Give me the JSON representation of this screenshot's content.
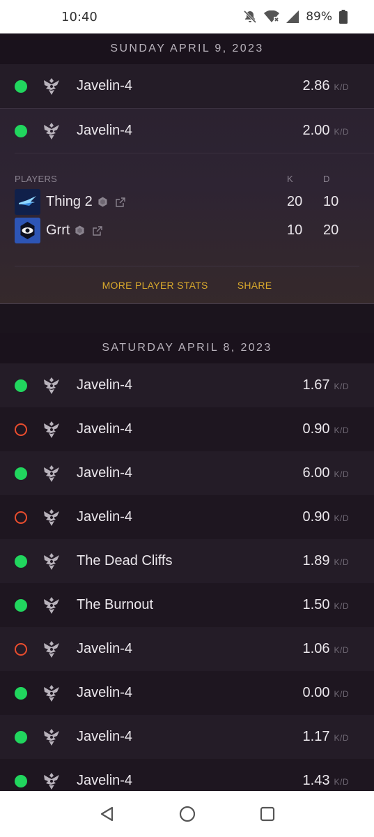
{
  "status": {
    "time": "10:40",
    "battery": "89%"
  },
  "sections": [
    {
      "date": "SUNDAY APRIL 9, 2023",
      "games": [
        {
          "map": "Javelin-4",
          "kd": "2.86",
          "result": "win"
        },
        {
          "map": "Javelin-4",
          "kd": "2.00",
          "result": "win",
          "expanded": true
        }
      ]
    },
    {
      "date": "SATURDAY APRIL 8, 2023",
      "games": [
        {
          "map": "Javelin-4",
          "kd": "1.67",
          "result": "win"
        },
        {
          "map": "Javelin-4",
          "kd": "0.90",
          "result": "loss"
        },
        {
          "map": "Javelin-4",
          "kd": "6.00",
          "result": "win"
        },
        {
          "map": "Javelin-4",
          "kd": "0.90",
          "result": "loss"
        },
        {
          "map": "The Dead Cliffs",
          "kd": "1.89",
          "result": "win"
        },
        {
          "map": "The Burnout",
          "kd": "1.50",
          "result": "win"
        },
        {
          "map": "Javelin-4",
          "kd": "1.06",
          "result": "loss"
        },
        {
          "map": "Javelin-4",
          "kd": "0.00",
          "result": "win"
        },
        {
          "map": "Javelin-4",
          "kd": "1.17",
          "result": "win"
        },
        {
          "map": "Javelin-4",
          "kd": "1.43",
          "result": "win"
        }
      ]
    }
  ],
  "kd_unit": "K/D",
  "expanded_game": {
    "players_label": "PLAYERS",
    "k_label": "K",
    "d_label": "D",
    "players": [
      {
        "name": "Thing 2",
        "k": "20",
        "d": "10",
        "emblem": "blue-bird-emblem"
      },
      {
        "name": "Grrt",
        "k": "10",
        "d": "20",
        "emblem": "eye-emblem"
      }
    ],
    "more_stats_label": "MORE PLAYER STATS",
    "share_label": "SHARE"
  },
  "colors": {
    "win": "#21d65e",
    "loss": "#ea4d2e",
    "accent": "#d9a92c"
  },
  "icons": {
    "map_crest": "iron-banner-crest-icon",
    "platform": "hexagon-platform-icon",
    "external": "external-link-icon"
  }
}
